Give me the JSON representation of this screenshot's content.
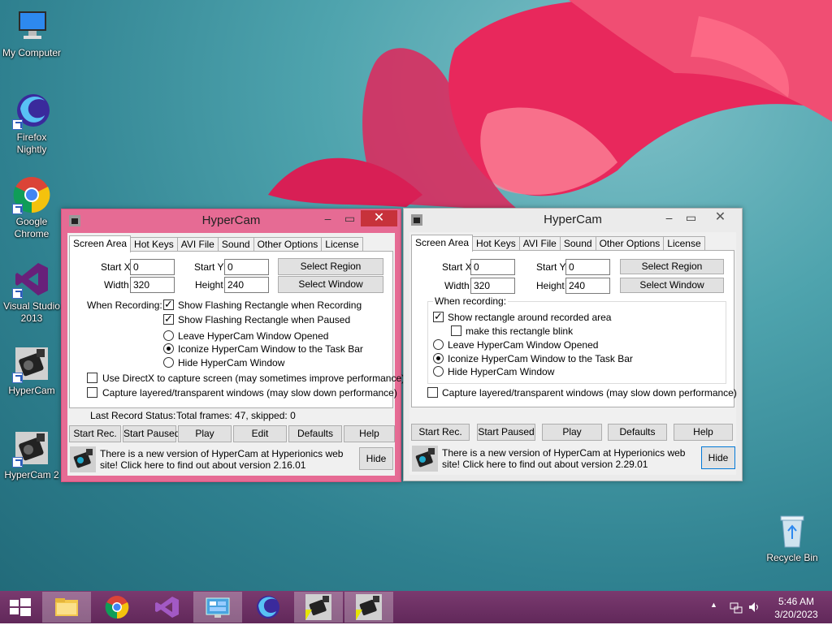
{
  "desktop": {
    "icons": [
      {
        "label": "My Computer"
      },
      {
        "label": "Firefox Nightly"
      },
      {
        "label": "Google Chrome"
      },
      {
        "label": "Visual Studio 2013"
      },
      {
        "label": "HyperCam"
      },
      {
        "label": "HyperCam 2"
      },
      {
        "label": "Recycle Bin"
      }
    ]
  },
  "win1": {
    "title": "HyperCam",
    "tabs": [
      "Screen Area",
      "Hot Keys",
      "AVI File",
      "Sound",
      "Other Options",
      "License"
    ],
    "start_x_label": "Start X",
    "start_x": "0",
    "start_y_label": "Start Y",
    "start_y": "0",
    "width_label": "Width",
    "width": "320",
    "height_label": "Height",
    "height": "240",
    "select_region": "Select Region",
    "select_window": "Select Window",
    "when_recording": "When Recording:",
    "opt_flash_rec": "Show Flashing Rectangle when Recording",
    "opt_flash_paused": "Show Flashing Rectangle when Paused",
    "opt_leave": "Leave HyperCam Window Opened",
    "opt_iconize": "Iconize HyperCam Window to the Task Bar",
    "opt_hide": "Hide HyperCam Window",
    "opt_directx": "Use DirectX to capture screen (may sometimes improve performance)",
    "opt_layered": "Capture layered/transparent windows (may slow down performance)",
    "status_label": "Last Record Status:",
    "status_value": "Total frames: 47, skipped: 0",
    "buttons": [
      "Start Rec.",
      "Start Paused",
      "Play",
      "Edit",
      "Defaults",
      "Help"
    ],
    "info": "There is a new version of HyperCam at Hyperionics web site! Click here to find out about version 2.16.01",
    "hide": "Hide"
  },
  "win2": {
    "title": "HyperCam",
    "tabs": [
      "Screen Area",
      "Hot Keys",
      "AVI File",
      "Sound",
      "Other Options",
      "License"
    ],
    "start_x_label": "Start X",
    "start_x": "0",
    "start_y_label": "Start Y",
    "start_y": "0",
    "width_label": "Width",
    "width": "320",
    "height_label": "Height",
    "height": "240",
    "select_region": "Select Region",
    "select_window": "Select Window",
    "when_recording": "When recording:",
    "opt_show_rect": "Show rectangle around recorded area",
    "opt_blink": "make this rectangle blink",
    "opt_leave": "Leave HyperCam Window Opened",
    "opt_iconize": "Iconize HyperCam Window to the Task Bar",
    "opt_hide": "Hide HyperCam Window",
    "opt_layered": "Capture layered/transparent windows (may slow down performance)",
    "buttons": [
      "Start Rec.",
      "Start Paused",
      "Play",
      "Defaults",
      "Help"
    ],
    "info": "There is a new version of HyperCam at Hyperionics web site! Click here to find out about version 2.29.01",
    "hide": "Hide"
  },
  "taskbar": {
    "time": "5:46 AM",
    "date": "3/20/2023"
  },
  "colors": {
    "active_frame": "#e66b94",
    "close_button": "#c7323b",
    "taskbar": "#6b2f63"
  }
}
